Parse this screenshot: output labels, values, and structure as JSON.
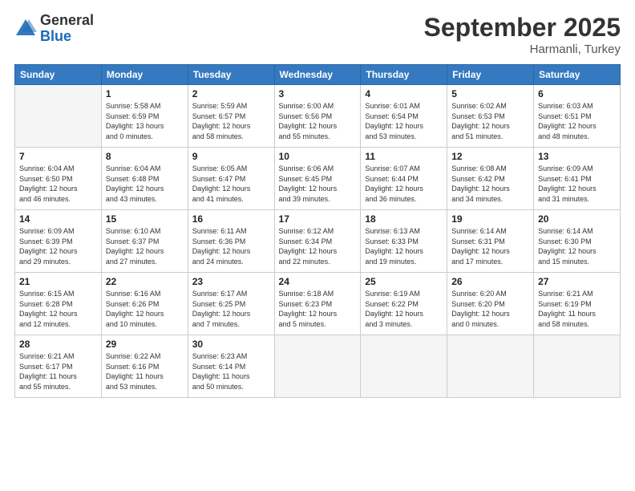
{
  "header": {
    "logo": {
      "line1": "General",
      "line2": "Blue"
    },
    "title": "September 2025",
    "subtitle": "Harmanli, Turkey"
  },
  "weekdays": [
    "Sunday",
    "Monday",
    "Tuesday",
    "Wednesday",
    "Thursday",
    "Friday",
    "Saturday"
  ],
  "weeks": [
    [
      {
        "day": "",
        "info": ""
      },
      {
        "day": "1",
        "info": "Sunrise: 5:58 AM\nSunset: 6:59 PM\nDaylight: 13 hours\nand 0 minutes."
      },
      {
        "day": "2",
        "info": "Sunrise: 5:59 AM\nSunset: 6:57 PM\nDaylight: 12 hours\nand 58 minutes."
      },
      {
        "day": "3",
        "info": "Sunrise: 6:00 AM\nSunset: 6:56 PM\nDaylight: 12 hours\nand 55 minutes."
      },
      {
        "day": "4",
        "info": "Sunrise: 6:01 AM\nSunset: 6:54 PM\nDaylight: 12 hours\nand 53 minutes."
      },
      {
        "day": "5",
        "info": "Sunrise: 6:02 AM\nSunset: 6:53 PM\nDaylight: 12 hours\nand 51 minutes."
      },
      {
        "day": "6",
        "info": "Sunrise: 6:03 AM\nSunset: 6:51 PM\nDaylight: 12 hours\nand 48 minutes."
      }
    ],
    [
      {
        "day": "7",
        "info": "Sunrise: 6:04 AM\nSunset: 6:50 PM\nDaylight: 12 hours\nand 46 minutes."
      },
      {
        "day": "8",
        "info": "Sunrise: 6:04 AM\nSunset: 6:48 PM\nDaylight: 12 hours\nand 43 minutes."
      },
      {
        "day": "9",
        "info": "Sunrise: 6:05 AM\nSunset: 6:47 PM\nDaylight: 12 hours\nand 41 minutes."
      },
      {
        "day": "10",
        "info": "Sunrise: 6:06 AM\nSunset: 6:45 PM\nDaylight: 12 hours\nand 39 minutes."
      },
      {
        "day": "11",
        "info": "Sunrise: 6:07 AM\nSunset: 6:44 PM\nDaylight: 12 hours\nand 36 minutes."
      },
      {
        "day": "12",
        "info": "Sunrise: 6:08 AM\nSunset: 6:42 PM\nDaylight: 12 hours\nand 34 minutes."
      },
      {
        "day": "13",
        "info": "Sunrise: 6:09 AM\nSunset: 6:41 PM\nDaylight: 12 hours\nand 31 minutes."
      }
    ],
    [
      {
        "day": "14",
        "info": "Sunrise: 6:09 AM\nSunset: 6:39 PM\nDaylight: 12 hours\nand 29 minutes."
      },
      {
        "day": "15",
        "info": "Sunrise: 6:10 AM\nSunset: 6:37 PM\nDaylight: 12 hours\nand 27 minutes."
      },
      {
        "day": "16",
        "info": "Sunrise: 6:11 AM\nSunset: 6:36 PM\nDaylight: 12 hours\nand 24 minutes."
      },
      {
        "day": "17",
        "info": "Sunrise: 6:12 AM\nSunset: 6:34 PM\nDaylight: 12 hours\nand 22 minutes."
      },
      {
        "day": "18",
        "info": "Sunrise: 6:13 AM\nSunset: 6:33 PM\nDaylight: 12 hours\nand 19 minutes."
      },
      {
        "day": "19",
        "info": "Sunrise: 6:14 AM\nSunset: 6:31 PM\nDaylight: 12 hours\nand 17 minutes."
      },
      {
        "day": "20",
        "info": "Sunrise: 6:14 AM\nSunset: 6:30 PM\nDaylight: 12 hours\nand 15 minutes."
      }
    ],
    [
      {
        "day": "21",
        "info": "Sunrise: 6:15 AM\nSunset: 6:28 PM\nDaylight: 12 hours\nand 12 minutes."
      },
      {
        "day": "22",
        "info": "Sunrise: 6:16 AM\nSunset: 6:26 PM\nDaylight: 12 hours\nand 10 minutes."
      },
      {
        "day": "23",
        "info": "Sunrise: 6:17 AM\nSunset: 6:25 PM\nDaylight: 12 hours\nand 7 minutes."
      },
      {
        "day": "24",
        "info": "Sunrise: 6:18 AM\nSunset: 6:23 PM\nDaylight: 12 hours\nand 5 minutes."
      },
      {
        "day": "25",
        "info": "Sunrise: 6:19 AM\nSunset: 6:22 PM\nDaylight: 12 hours\nand 3 minutes."
      },
      {
        "day": "26",
        "info": "Sunrise: 6:20 AM\nSunset: 6:20 PM\nDaylight: 12 hours\nand 0 minutes."
      },
      {
        "day": "27",
        "info": "Sunrise: 6:21 AM\nSunset: 6:19 PM\nDaylight: 11 hours\nand 58 minutes."
      }
    ],
    [
      {
        "day": "28",
        "info": "Sunrise: 6:21 AM\nSunset: 6:17 PM\nDaylight: 11 hours\nand 55 minutes."
      },
      {
        "day": "29",
        "info": "Sunrise: 6:22 AM\nSunset: 6:16 PM\nDaylight: 11 hours\nand 53 minutes."
      },
      {
        "day": "30",
        "info": "Sunrise: 6:23 AM\nSunset: 6:14 PM\nDaylight: 11 hours\nand 50 minutes."
      },
      {
        "day": "",
        "info": ""
      },
      {
        "day": "",
        "info": ""
      },
      {
        "day": "",
        "info": ""
      },
      {
        "day": "",
        "info": ""
      }
    ]
  ]
}
